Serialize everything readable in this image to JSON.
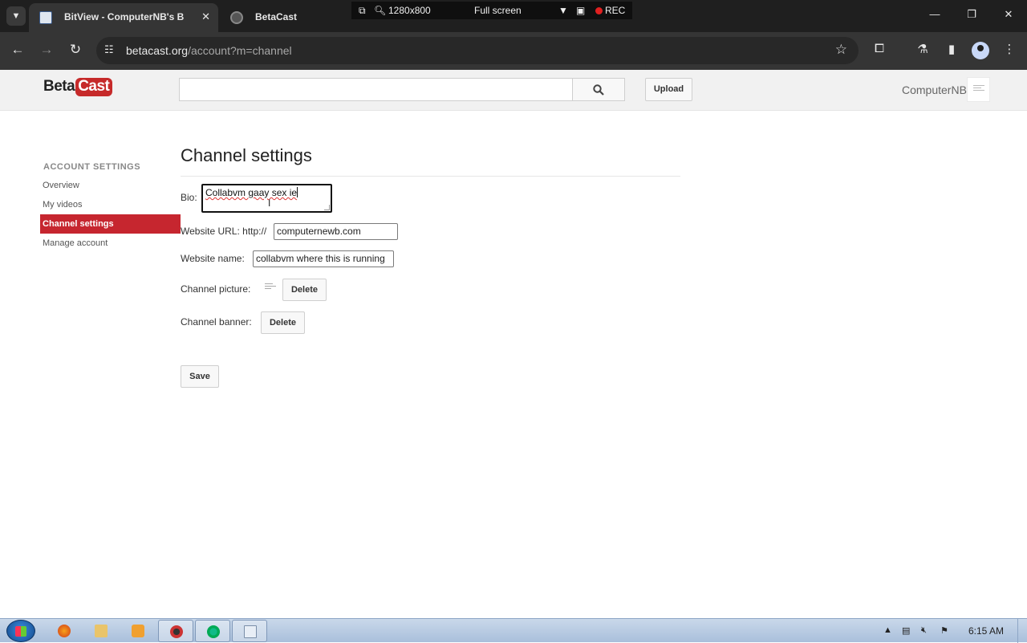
{
  "browser": {
    "tabs": [
      {
        "title": "BitView - ComputerNB's BitView",
        "active": true
      },
      {
        "title": "BetaCast",
        "active": false
      }
    ],
    "tab_close_glyph": "✕",
    "recorder": {
      "resolution": "1280x800",
      "mode": "Full screen",
      "rec_label": "REC"
    },
    "url_host": "betacast.org",
    "url_path": "/account?m=channel"
  },
  "site": {
    "logo_beta": "Beta",
    "logo_cast": "Cast",
    "search_value": "",
    "upload_label": "Upload",
    "username": "ComputerNB"
  },
  "sidebar": {
    "heading": "ACCOUNT SETTINGS",
    "items": [
      {
        "label": "Overview"
      },
      {
        "label": "My videos"
      },
      {
        "label": "Channel settings",
        "active": true
      },
      {
        "label": "Manage account"
      }
    ]
  },
  "main": {
    "title": "Channel settings",
    "bio_label": "Bio:",
    "bio_value": "Collabvm gaay sex ie",
    "website_url_label": "Website URL: http://",
    "website_url_value": "computernewb.com",
    "website_name_label": "Website name:",
    "website_name_value": "collabvm where this is running",
    "channel_picture_label": "Channel picture:",
    "channel_banner_label": "Channel banner:",
    "delete_label": "Delete",
    "save_label": "Save"
  },
  "taskbar": {
    "clock": "6:15 AM"
  },
  "colors": {
    "accent_red": "#c6262f",
    "browser_dark": "#1f1f1f",
    "taskbar": "#b8cce4"
  },
  "icons": [
    "search-icon",
    "star-icon",
    "extensions-icon",
    "labs-icon",
    "side-panel-icon",
    "profile-icon",
    "menu-icon",
    "back-icon",
    "forward-icon",
    "reload-icon",
    "site-info-icon",
    "camera-icon"
  ]
}
